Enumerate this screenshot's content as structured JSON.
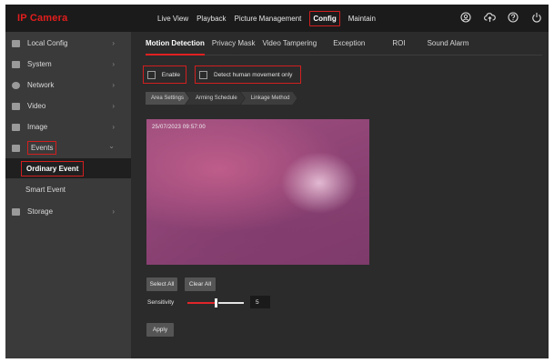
{
  "app": {
    "logo": "IP Camera"
  },
  "topnav": {
    "items": [
      {
        "label": "Live View",
        "active": false
      },
      {
        "label": "Playback",
        "active": false
      },
      {
        "label": "Picture Management",
        "active": false
      },
      {
        "label": "Config",
        "active": true
      },
      {
        "label": "Maintain",
        "active": false
      }
    ],
    "icons": [
      "user-icon",
      "cloud-upload-icon",
      "help-icon",
      "power-icon"
    ]
  },
  "sidebar": {
    "items": [
      {
        "label": "Local Config",
        "icon": "monitor-icon",
        "arrow": "›"
      },
      {
        "label": "System",
        "icon": "settings-icon",
        "arrow": "›"
      },
      {
        "label": "Network",
        "icon": "network-icon",
        "arrow": "›"
      },
      {
        "label": "Video",
        "icon": "video-icon",
        "arrow": "›"
      },
      {
        "label": "Image",
        "icon": "image-icon",
        "arrow": "›"
      },
      {
        "label": "Events",
        "icon": "calendar-icon",
        "arrow": "⌄"
      },
      {
        "label": "Storage",
        "icon": "storage-icon",
        "arrow": "›"
      }
    ],
    "events_sub": [
      {
        "label": "Ordinary Event",
        "active": true
      },
      {
        "label": "Smart Event",
        "active": false
      }
    ]
  },
  "tabs": [
    {
      "label": "Motion Detection",
      "active": true
    },
    {
      "label": "Privacy Mask",
      "active": false
    },
    {
      "label": "Video Tampering",
      "active": false
    },
    {
      "label": "Exception",
      "active": false
    },
    {
      "label": "ROI",
      "active": false
    },
    {
      "label": "Sound Alarm",
      "active": false
    }
  ],
  "options": {
    "enable_label": "Enable",
    "enable_checked": false,
    "human_label": "Detect human movement only",
    "human_checked": false
  },
  "steps": [
    "Area Settings",
    "Arming Schedule",
    "Linkage Method"
  ],
  "video": {
    "timestamp": "25/07/2023  09:57:00"
  },
  "buttons": {
    "select_all": "Select All",
    "clear_all": "Clear All",
    "apply": "Apply"
  },
  "sensitivity": {
    "label": "Sensitivity",
    "value": "5",
    "level": 0.5
  },
  "colors": {
    "accent": "#d21f1f",
    "topbar": "#1b1b1b",
    "sidebar": "#3a3a3a",
    "panel": "#2b2b2b"
  }
}
